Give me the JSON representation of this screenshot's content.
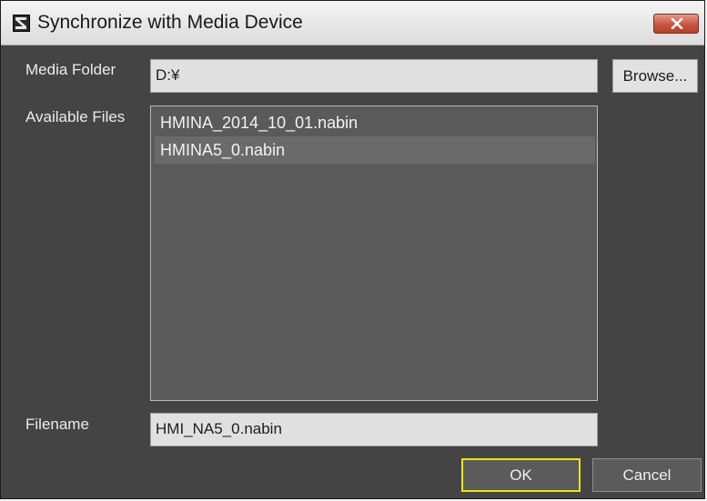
{
  "window": {
    "title": "Synchronize with Media Device",
    "close_icon": "close-icon",
    "app_icon": "sysmac-icon"
  },
  "media_folder": {
    "label": "Media Folder",
    "value": "D:¥",
    "browse_label": "Browse..."
  },
  "available_files": {
    "label": "Available Files",
    "items": [
      {
        "name": "HMINA_2014_10_01.nabin",
        "selected": false
      },
      {
        "name": "HMINA5_0.nabin",
        "selected": true
      }
    ]
  },
  "filename": {
    "label": "Filename",
    "value": "HMI_NA5_0.nabin"
  },
  "buttons": {
    "ok_label": "OK",
    "cancel_label": "Cancel"
  },
  "colors": {
    "background": "#444444",
    "focus_border": "#f5e400",
    "close_button": "#c8553f"
  }
}
